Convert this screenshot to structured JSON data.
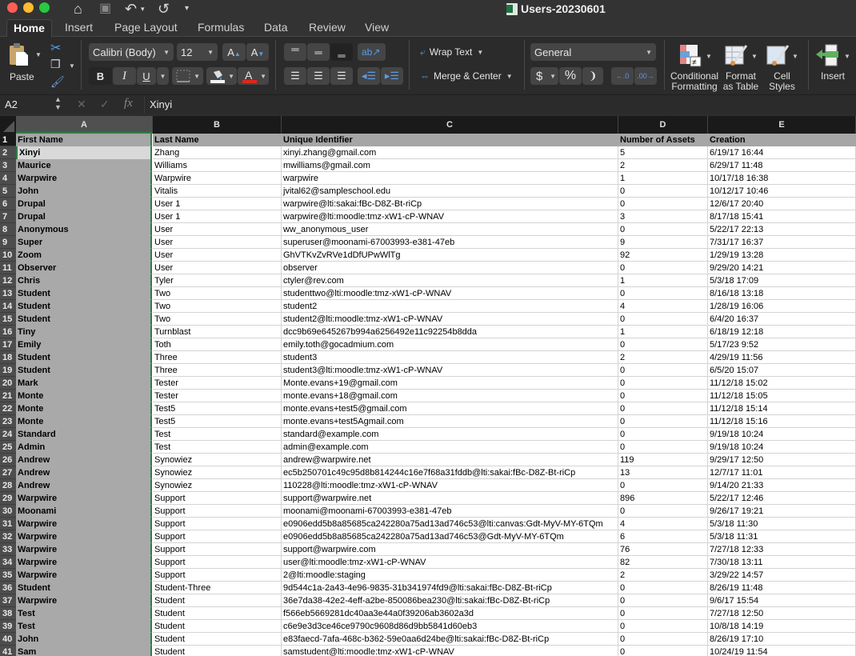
{
  "window": {
    "title": "Users-20230601"
  },
  "quick_access": {
    "home": "⌂",
    "save": "▣",
    "undo": "↶",
    "redo": "↺",
    "customize": "▾"
  },
  "tabs": [
    "Home",
    "Insert",
    "Page Layout",
    "Formulas",
    "Data",
    "Review",
    "View"
  ],
  "active_tab": "Home",
  "ribbon": {
    "paste_label": "Paste",
    "font_name": "Calibri (Body)",
    "font_size": "12",
    "bold": "B",
    "italic": "I",
    "underline": "U",
    "wrap_text": "Wrap Text",
    "merge_center": "Merge & Center",
    "number_format": "General",
    "currency": "$",
    "percent": "%",
    "comma": "❩",
    "conditional_formatting": "Conditional Formatting",
    "conditional_formatting_l1": "Conditional",
    "conditional_formatting_l2": "Formatting",
    "format_as_table_l1": "Format",
    "format_as_table_l2": "as Table",
    "cell_styles_l1": "Cell",
    "cell_styles_l2": "Styles",
    "insert_label": "Insert",
    "colors": {
      "font_color": "#e0261b",
      "fill_color": "#f4f4f4",
      "accent": "#2f7d45"
    }
  },
  "formula_bar": {
    "cell_ref": "A2",
    "fx": "fx",
    "value": "Xinyi"
  },
  "columns": [
    "A",
    "B",
    "C",
    "D",
    "E"
  ],
  "header_row": {
    "num": "1",
    "cells": [
      "First Name",
      "Last Name",
      "Unique Identifier",
      "Number of Assets",
      "Creation"
    ]
  },
  "rows": [
    {
      "num": "2",
      "cells": [
        "Xinyi",
        "Zhang",
        "xinyi.zhang@gmail.com",
        "5",
        "6/19/17 16:44"
      ]
    },
    {
      "num": "3",
      "cells": [
        "Maurice",
        "Williams",
        "mwilliams@gmail.com",
        "2",
        "6/29/17 11:48"
      ]
    },
    {
      "num": "4",
      "cells": [
        "Warpwire",
        "Warpwire",
        "warpwire",
        "1",
        "10/17/18 16:38"
      ]
    },
    {
      "num": "5",
      "cells": [
        "John",
        "Vitalis",
        "jvital62@sampleschool.edu",
        "0",
        "10/12/17 10:46"
      ]
    },
    {
      "num": "6",
      "cells": [
        "Drupal",
        "User 1",
        "warpwire@lti:sakai:fBc-D8Z-Bt-riCp",
        "0",
        "12/6/17 20:40"
      ]
    },
    {
      "num": "7",
      "cells": [
        "Drupal",
        "User 1",
        "warpwire@lti:moodle:tmz-xW1-cP-WNAV",
        "3",
        "8/17/18 15:41"
      ]
    },
    {
      "num": "8",
      "cells": [
        "Anonymous",
        "User",
        "ww_anonymous_user",
        "0",
        "5/22/17 22:13"
      ]
    },
    {
      "num": "9",
      "cells": [
        "Super",
        "User",
        "superuser@moonami-67003993-e381-47eb",
        "9",
        "7/31/17 16:37"
      ]
    },
    {
      "num": "10",
      "cells": [
        "Zoom",
        "User",
        "GhVTKvZvRVe1dDfUPwWlTg",
        "92",
        "1/29/19 13:28"
      ]
    },
    {
      "num": "11",
      "cells": [
        "Observer",
        "User",
        "observer",
        "0",
        "9/29/20 14:21"
      ]
    },
    {
      "num": "12",
      "cells": [
        "Chris",
        "Tyler",
        "ctyler@rev.com",
        "1",
        "5/3/18 17:09"
      ]
    },
    {
      "num": "13",
      "cells": [
        "Student",
        "Two",
        "studenttwo@lti:moodle:tmz-xW1-cP-WNAV",
        "0",
        "8/16/18 13:18"
      ]
    },
    {
      "num": "14",
      "cells": [
        "Student",
        "Two",
        "student2",
        "4",
        "1/28/19 16:06"
      ]
    },
    {
      "num": "15",
      "cells": [
        "Student",
        "Two",
        "student2@lti:moodle:tmz-xW1-cP-WNAV",
        "0",
        "6/4/20 16:37"
      ]
    },
    {
      "num": "16",
      "cells": [
        "Tiny",
        "Turnblast",
        "dcc9b69e645267b994a6256492e11c92254b8dda",
        "1",
        "6/18/19 12:18"
      ]
    },
    {
      "num": "17",
      "cells": [
        "Emily",
        "Toth",
        "emily.toth@gocadmium.com",
        "0",
        "5/17/23 9:52"
      ]
    },
    {
      "num": "18",
      "cells": [
        "Student",
        "Three",
        "student3",
        "2",
        "4/29/19 11:56"
      ]
    },
    {
      "num": "19",
      "cells": [
        "Student",
        "Three",
        "student3@lti:moodle:tmz-xW1-cP-WNAV",
        "0",
        "6/5/20 15:07"
      ]
    },
    {
      "num": "20",
      "cells": [
        "Mark",
        "Tester",
        "Monte.evans+19@gmail.com",
        "0",
        "11/12/18 15:02"
      ]
    },
    {
      "num": "21",
      "cells": [
        "Monte",
        "Tester",
        "monte.evans+18@gmail.com",
        "0",
        "11/12/18 15:05"
      ]
    },
    {
      "num": "22",
      "cells": [
        "Monte",
        "Test5",
        "monte.evans+test5@gmail.com",
        "0",
        "11/12/18 15:14"
      ]
    },
    {
      "num": "23",
      "cells": [
        "Monte",
        "Test5",
        "monte.evans+test5Agmail.com",
        "0",
        "11/12/18 15:16"
      ]
    },
    {
      "num": "24",
      "cells": [
        "Standard",
        "Test",
        "standard@example.com",
        "0",
        "9/19/18 10:24"
      ]
    },
    {
      "num": "25",
      "cells": [
        "Admin",
        "Test",
        "admin@example.com",
        "0",
        "9/19/18 10:24"
      ]
    },
    {
      "num": "26",
      "cells": [
        "Andrew",
        "Synowiez",
        "andrew@warpwire.net",
        "119",
        "9/29/17 12:50"
      ]
    },
    {
      "num": "27",
      "cells": [
        "Andrew",
        "Synowiez",
        "ec5b250701c49c95d8b814244c16e7f68a31fddb@lti:sakai:fBc-D8Z-Bt-riCp",
        "13",
        "12/7/17 11:01"
      ]
    },
    {
      "num": "28",
      "cells": [
        "Andrew",
        "Synowiez",
        "110228@lti:moodle:tmz-xW1-cP-WNAV",
        "0",
        "9/14/20 21:33"
      ]
    },
    {
      "num": "29",
      "cells": [
        "Warpwire",
        "Support",
        "support@warpwire.net",
        "896",
        "5/22/17 12:46"
      ]
    },
    {
      "num": "30",
      "cells": [
        "Moonami",
        "Support",
        "moonami@moonami-67003993-e381-47eb",
        "0",
        "9/26/17 19:21"
      ]
    },
    {
      "num": "31",
      "cells": [
        "Warpwire",
        "Support",
        "e0906edd5b8a85685ca242280a75ad13ad746c53@lti:canvas:Gdt-MyV-MY-6TQm",
        "4",
        "5/3/18 11:30"
      ]
    },
    {
      "num": "32",
      "cells": [
        "Warpwire",
        "Support",
        "e0906edd5b8a85685ca242280a75ad13ad746c53@Gdt-MyV-MY-6TQm",
        "6",
        "5/3/18 11:31"
      ]
    },
    {
      "num": "33",
      "cells": [
        "Warpwire",
        "Support",
        "support@warpwire.com",
        "76",
        "7/27/18 12:33"
      ]
    },
    {
      "num": "34",
      "cells": [
        "Warpwire",
        "Support",
        "user@lti:moodle:tmz-xW1-cP-WNAV",
        "82",
        "7/30/18 13:11"
      ]
    },
    {
      "num": "35",
      "cells": [
        "Warpwire",
        "Support",
        "2@lti:moodle:staging",
        "2",
        "3/29/22 14:57"
      ]
    },
    {
      "num": "36",
      "cells": [
        "Student",
        "Student-Three",
        "9d544c1a-2a43-4e96-9835-31b341974fd9@lti:sakai:fBc-D8Z-Bt-riCp",
        "0",
        "8/26/19 11:48"
      ]
    },
    {
      "num": "37",
      "cells": [
        "Warpwire",
        "Student",
        "36e7da38-42e2-4eff-a2be-850086bea230@lti:sakai:fBc-D8Z-Bt-riCp",
        "0",
        "9/6/17 15:54"
      ]
    },
    {
      "num": "38",
      "cells": [
        "Test",
        "Student",
        "f566eb5669281dc40aa3e44a0f39206ab3602a3d",
        "0",
        "7/27/18 12:50"
      ]
    },
    {
      "num": "39",
      "cells": [
        "Test",
        "Student",
        "c6e9e3d3ce46ce9790c9608d86d9bb5841d60eb3",
        "0",
        "10/8/18 14:19"
      ]
    },
    {
      "num": "40",
      "cells": [
        "John",
        "Student",
        "e83faecd-7afa-468c-b362-59e0aa6d24be@lti:sakai:fBc-D8Z-Bt-riCp",
        "0",
        "8/26/19 17:10"
      ]
    },
    {
      "num": "41",
      "cells": [
        "Sam",
        "Student",
        "samstudent@lti:moodle:tmz-xW1-cP-WNAV",
        "0",
        "10/24/19 11:54"
      ]
    }
  ]
}
